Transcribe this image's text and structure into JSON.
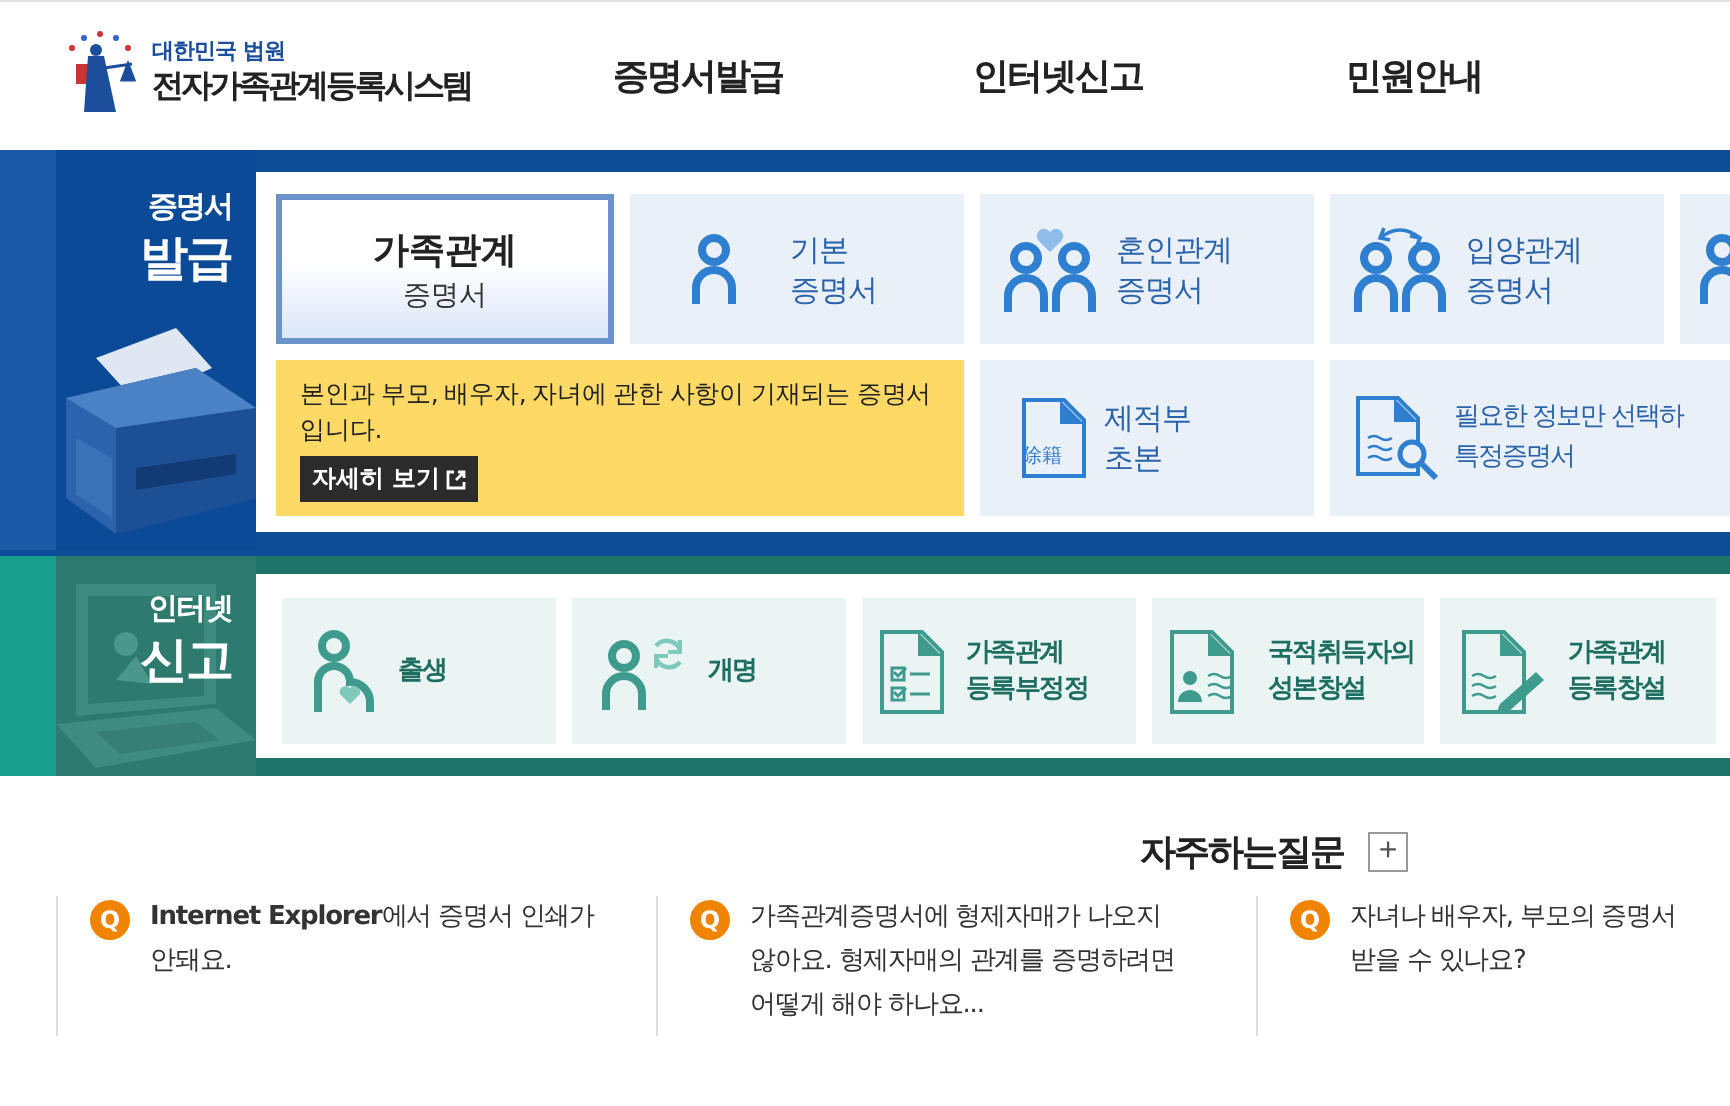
{
  "header": {
    "org": "대한민국 법원",
    "title": "전자가족관계등록시스템",
    "nav": [
      {
        "label": "증명서발급"
      },
      {
        "label": "인터넷신고"
      },
      {
        "label": "민원안내"
      }
    ]
  },
  "certificates": {
    "heading_small": "증명서",
    "heading_large": "발급",
    "cards": [
      {
        "kind": "featured",
        "lines": [
          "가족관계",
          "증명서"
        ],
        "selected": true
      },
      {
        "kind": "person",
        "lines": [
          "기본",
          "증명서"
        ],
        "selected": false
      },
      {
        "kind": "couple-heart",
        "lines": [
          "혼인관계",
          "증명서"
        ],
        "selected": false
      },
      {
        "kind": "couple-arrows",
        "lines": [
          "입양관계",
          "증명서"
        ],
        "selected": false
      },
      {
        "kind": "partial",
        "selected": false
      },
      {
        "kind": "removed-register",
        "icon_text": "除籍",
        "lines": [
          "제적부",
          "초본"
        ],
        "selected": false
      },
      {
        "kind": "document-search",
        "lines": [
          "필요한 정보만 선택하",
          "특정증명서"
        ],
        "selected": false
      }
    ],
    "tooltip": {
      "text": "본인과 부모, 배우자, 자녀에 관한 사항이 기재되는 증명서입니다.",
      "button": "자세히 보기"
    }
  },
  "reports": {
    "heading_small": "인터넷",
    "heading_large": "신고",
    "cards": [
      {
        "kind": "birth",
        "lines": [
          "출생"
        ]
      },
      {
        "kind": "rename",
        "lines": [
          "개명"
        ]
      },
      {
        "kind": "checklist",
        "lines": [
          "가족관계",
          "등록부정정"
        ]
      },
      {
        "kind": "id-document",
        "lines": [
          "국적취득자의",
          "성본창설"
        ]
      },
      {
        "kind": "pen-document",
        "lines": [
          "가족관계",
          "등록창설"
        ]
      }
    ]
  },
  "faq": {
    "title": "자주하는질문",
    "more": "+",
    "items": [
      {
        "badge": "Q",
        "text": "**Internet Explorer**에서 증명서 인쇄가 안돼요."
      },
      {
        "badge": "Q",
        "text": "가족관계증명서에 형제자매가 나오지 않아요. 형제자매의 관계를 증명하려면 어떻게 해야 하나요..."
      },
      {
        "badge": "Q",
        "text": "자녀나 배우자, 부모의 증명서 받을 수 있나요?"
      }
    ]
  }
}
